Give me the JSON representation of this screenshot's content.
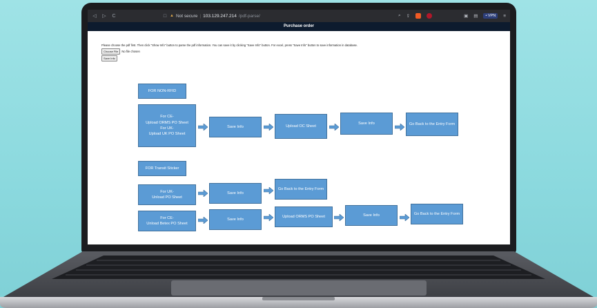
{
  "browser": {
    "back": "◁",
    "forward": "▷",
    "reload": "C",
    "bookmark": "□",
    "warning": "▲",
    "not_secure": "Not secure",
    "separator": "|",
    "host": "103.129.247.214",
    "path": "/pdf-parse/",
    "vpn": "• VPN",
    "menu": "≡"
  },
  "app": {
    "title": "Purchase order",
    "instructions": "Please choose the pdf first. Then click \"Show Info\" button to parse the pdf information. You can save it by clicking \"Save Info\" button. For excel, press \"Save Info\" button to save information in database.",
    "choose_file": "Choose File",
    "no_file": "No file chosen",
    "save_info": "Save Info"
  },
  "diagram": {
    "non_rfid": "FOR NON-RFID",
    "ce_uk_lines": [
      "For CE-",
      "Upload ORMS PO Sheet",
      "For UK-",
      "Upload UK PO Sheet"
    ],
    "save_info_1": "Save Info",
    "upload_oc": "Upload OC Sheet",
    "save_info_2": "Save Info",
    "back_1": "Go Back to the Entry Form",
    "transit": "FOR Transit Sticker",
    "uk_lines": [
      "For UK-",
      "Unload PO Sheet"
    ],
    "save_info_3": "Save Info",
    "back_2": "Go Back to the Entry Form",
    "ce_lines": [
      "For CE-",
      "Unload Betex PO Sheet"
    ],
    "save_info_4": "Save Info",
    "upload_orms": "Upload ORMS PO Sheet",
    "save_info_5": "Save Info",
    "back_3": "Go Back to the Entry Form"
  },
  "colors": {
    "box_fill": "#5b9bd5",
    "box_border": "#41719c",
    "header_bg": "#0d1b2e"
  }
}
